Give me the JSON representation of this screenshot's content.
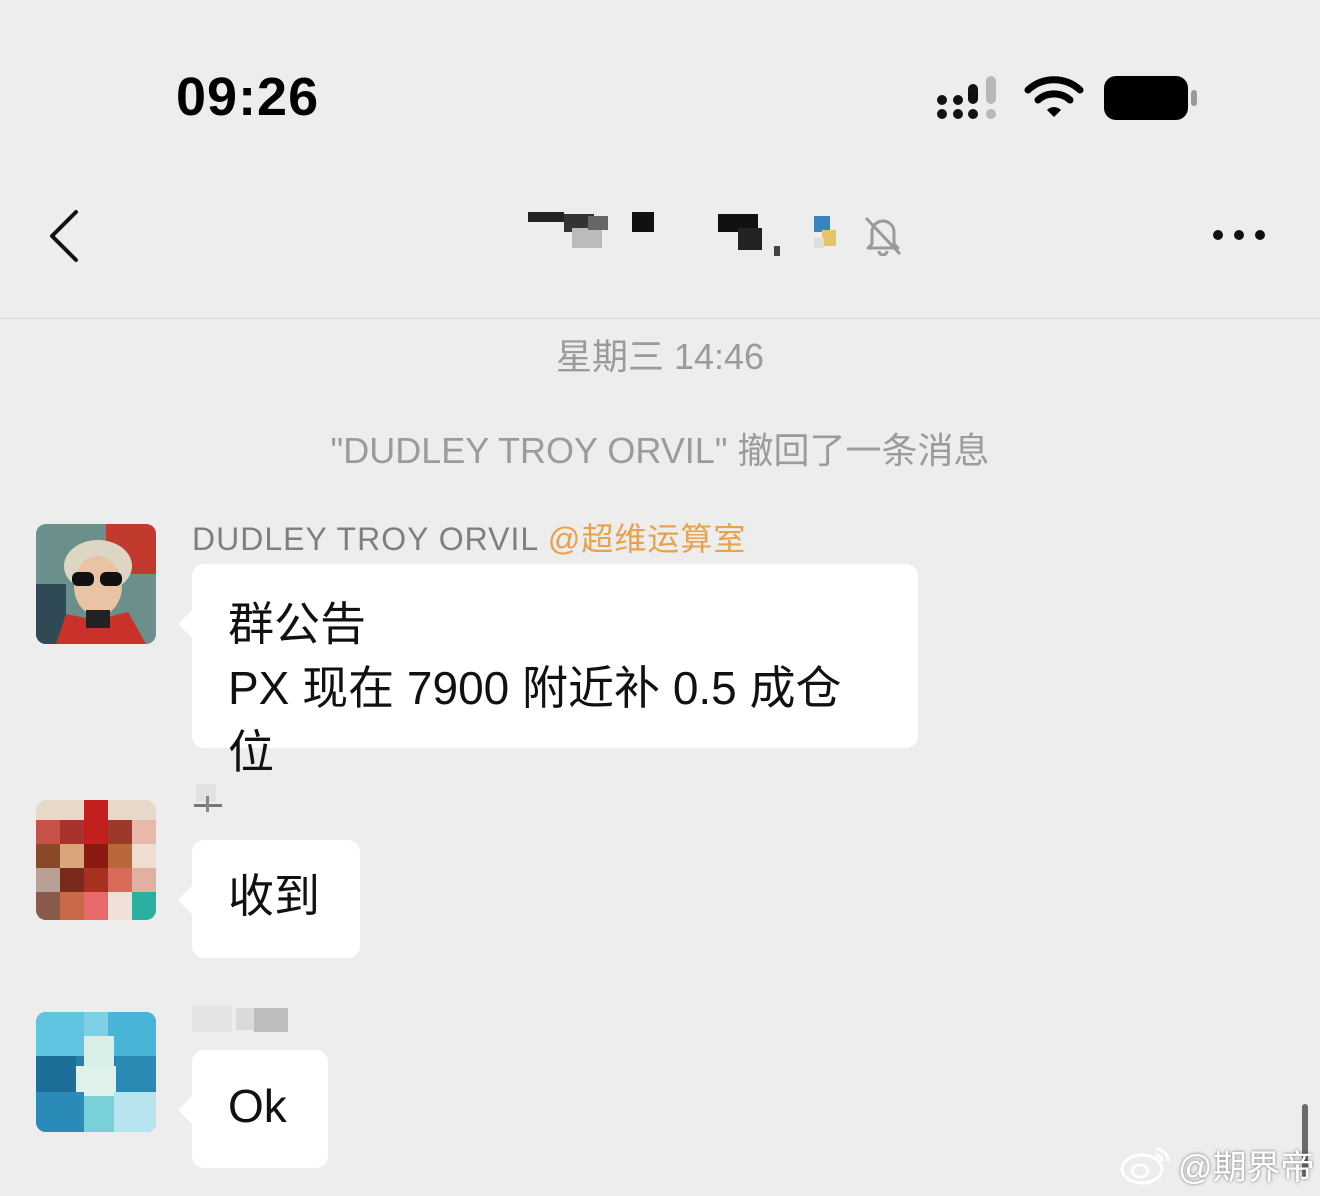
{
  "status_bar": {
    "time": "09:26"
  },
  "nav": {
    "back_icon": "chevron-left-icon",
    "mute_icon": "bell-off-icon",
    "more_icon": "ellipsis-icon"
  },
  "chat": {
    "timestamp": "星期三 14:46",
    "recall_notice": "\"DUDLEY TROY ORVIL\" 撤回了一条消息",
    "messages": [
      {
        "sender": "DUDLEY TROY ORVIL",
        "mention": "@超维运算室",
        "lines": [
          "群公告",
          "PX 现在 7900 附近补 0.5 成仓位"
        ]
      },
      {
        "sender": "",
        "lines": [
          "收到"
        ]
      },
      {
        "sender": "",
        "lines": [
          "Ok"
        ]
      }
    ]
  },
  "watermark": {
    "text": "@期界帝",
    "icon": "weibo-icon"
  },
  "colors": {
    "background": "#ededed",
    "bubble": "#ffffff",
    "mention": "#e8a24a",
    "system_text": "#9b9b9b"
  }
}
